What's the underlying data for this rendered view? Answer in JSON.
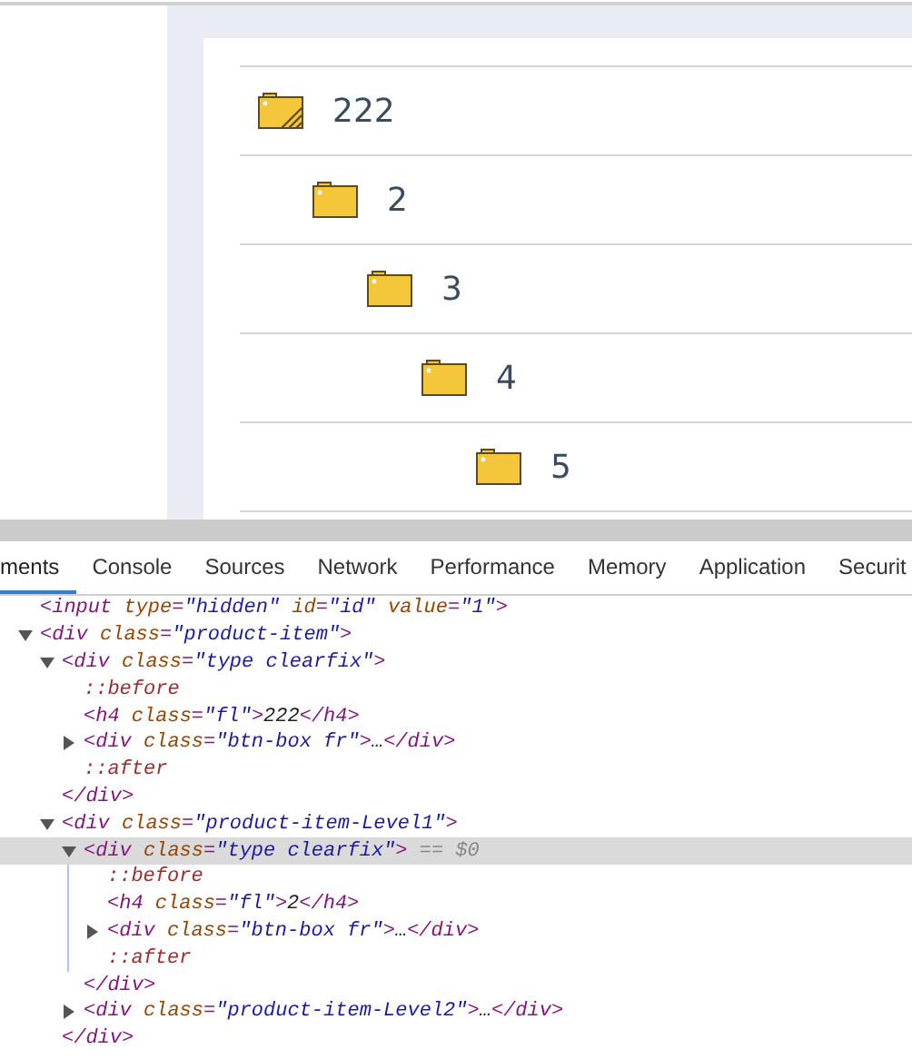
{
  "folders": [
    {
      "label": "222",
      "kind": "hatched",
      "children": [
        {
          "label": "2",
          "kind": "plain",
          "children": [
            {
              "label": "3",
              "kind": "plain",
              "children": [
                {
                  "label": "4",
                  "kind": "plain",
                  "children": [
                    {
                      "label": "5",
                      "kind": "plain"
                    }
                  ]
                }
              ]
            }
          ]
        }
      ]
    }
  ],
  "devtools": {
    "tabs": [
      {
        "label": "ments",
        "selected": true
      },
      {
        "label": "Console",
        "selected": false
      },
      {
        "label": "Sources",
        "selected": false
      },
      {
        "label": "Network",
        "selected": false
      },
      {
        "label": "Performance",
        "selected": false
      },
      {
        "label": "Memory",
        "selected": false
      },
      {
        "label": "Application",
        "selected": false
      },
      {
        "label": "Securit",
        "selected": false
      }
    ],
    "dom_tree": [
      {
        "kind": "leaf",
        "selected": false,
        "segments": [
          {
            "kind": "tag",
            "s": "<input"
          },
          {
            "kind": "attr",
            "s": " type"
          },
          {
            "kind": "tag",
            "s": "="
          },
          {
            "kind": "value",
            "s": "\"hidden\""
          },
          {
            "kind": "attr",
            "s": " id"
          },
          {
            "kind": "tag",
            "s": "="
          },
          {
            "kind": "value",
            "s": "\"id\""
          },
          {
            "kind": "attr",
            "s": " value"
          },
          {
            "kind": "tag",
            "s": "="
          },
          {
            "kind": "value",
            "s": "\"1\""
          },
          {
            "kind": "tag",
            "s": ">"
          }
        ]
      },
      {
        "kind": "parent",
        "expanded": true,
        "selected": false,
        "segments": [
          {
            "kind": "tag",
            "s": "<div"
          },
          {
            "kind": "attr",
            "s": " class"
          },
          {
            "kind": "tag",
            "s": "="
          },
          {
            "kind": "value",
            "s": "\"product-item\""
          },
          {
            "kind": "tag",
            "s": ">"
          }
        ],
        "children": [
          {
            "kind": "parent",
            "expanded": true,
            "selected": false,
            "segments": [
              {
                "kind": "tag",
                "s": "<div"
              },
              {
                "kind": "attr",
                "s": " class"
              },
              {
                "kind": "tag",
                "s": "="
              },
              {
                "kind": "value",
                "s": "\"type clearfix\""
              },
              {
                "kind": "tag",
                "s": ">"
              }
            ],
            "closing": [
              {
                "kind": "tag",
                "s": "</div>"
              }
            ],
            "children": [
              {
                "kind": "leaf",
                "selected": false,
                "segments": [
                  {
                    "kind": "pseudo",
                    "s": "::before"
                  }
                ]
              },
              {
                "kind": "leaf",
                "selected": false,
                "segments": [
                  {
                    "kind": "tag",
                    "s": "<h4"
                  },
                  {
                    "kind": "attr",
                    "s": " class"
                  },
                  {
                    "kind": "tag",
                    "s": "="
                  },
                  {
                    "kind": "value",
                    "s": "\"fl\""
                  },
                  {
                    "kind": "tag",
                    "s": ">"
                  },
                  {
                    "kind": "text",
                    "s": "222"
                  },
                  {
                    "kind": "tag",
                    "s": "</h4>"
                  }
                ]
              },
              {
                "kind": "parent",
                "expanded": false,
                "selected": false,
                "segments": [
                  {
                    "kind": "tag",
                    "s": "<div"
                  },
                  {
                    "kind": "attr",
                    "s": " class"
                  },
                  {
                    "kind": "tag",
                    "s": "="
                  },
                  {
                    "kind": "value",
                    "s": "\"btn-box fr\""
                  },
                  {
                    "kind": "tag",
                    "s": ">"
                  },
                  {
                    "kind": "text",
                    "s": "…"
                  },
                  {
                    "kind": "tag",
                    "s": "</div>"
                  }
                ]
              },
              {
                "kind": "leaf",
                "selected": false,
                "segments": [
                  {
                    "kind": "pseudo",
                    "s": "::after"
                  }
                ]
              }
            ]
          },
          {
            "kind": "parent",
            "expanded": true,
            "selected": false,
            "segments": [
              {
                "kind": "tag",
                "s": "<div"
              },
              {
                "kind": "attr",
                "s": " class"
              },
              {
                "kind": "tag",
                "s": "="
              },
              {
                "kind": "value",
                "s": "\"product-item-Level1\""
              },
              {
                "kind": "tag",
                "s": ">"
              }
            ],
            "closing": [
              {
                "kind": "tag",
                "s": "</div>"
              }
            ],
            "children": [
              {
                "kind": "parent",
                "expanded": true,
                "selected": true,
                "segments": [
                  {
                    "kind": "tag",
                    "s": "<div"
                  },
                  {
                    "kind": "attr",
                    "s": " class"
                  },
                  {
                    "kind": "tag",
                    "s": "="
                  },
                  {
                    "kind": "value",
                    "s": "\"type clearfix\""
                  },
                  {
                    "kind": "tag",
                    "s": ">"
                  },
                  {
                    "kind": "suffix",
                    "s": " == $0"
                  }
                ],
                "closing": [
                  {
                    "kind": "tag",
                    "s": "</div>"
                  }
                ],
                "children": [
                  {
                    "kind": "leaf",
                    "selected": false,
                    "segments": [
                      {
                        "kind": "pseudo",
                        "s": "::before"
                      }
                    ]
                  },
                  {
                    "kind": "leaf",
                    "selected": false,
                    "segments": [
                      {
                        "kind": "tag",
                        "s": "<h4"
                      },
                      {
                        "kind": "attr",
                        "s": " class"
                      },
                      {
                        "kind": "tag",
                        "s": "="
                      },
                      {
                        "kind": "value",
                        "s": "\"fl\""
                      },
                      {
                        "kind": "tag",
                        "s": ">"
                      },
                      {
                        "kind": "text",
                        "s": "2"
                      },
                      {
                        "kind": "tag",
                        "s": "</h4>"
                      }
                    ]
                  },
                  {
                    "kind": "parent",
                    "expanded": false,
                    "selected": false,
                    "segments": [
                      {
                        "kind": "tag",
                        "s": "<div"
                      },
                      {
                        "kind": "attr",
                        "s": " class"
                      },
                      {
                        "kind": "tag",
                        "s": "="
                      },
                      {
                        "kind": "value",
                        "s": "\"btn-box fr\""
                      },
                      {
                        "kind": "tag",
                        "s": ">"
                      },
                      {
                        "kind": "text",
                        "s": "…"
                      },
                      {
                        "kind": "tag",
                        "s": "</div>"
                      }
                    ]
                  },
                  {
                    "kind": "leaf",
                    "selected": false,
                    "segments": [
                      {
                        "kind": "pseudo",
                        "s": "::after"
                      }
                    ]
                  }
                ]
              },
              {
                "kind": "parent",
                "expanded": false,
                "selected": false,
                "segments": [
                  {
                    "kind": "tag",
                    "s": "<div"
                  },
                  {
                    "kind": "attr",
                    "s": " class"
                  },
                  {
                    "kind": "tag",
                    "s": "="
                  },
                  {
                    "kind": "value",
                    "s": "\"product-item-Level2\""
                  },
                  {
                    "kind": "tag",
                    "s": ">"
                  },
                  {
                    "kind": "text",
                    "s": "…"
                  },
                  {
                    "kind": "tag",
                    "s": "</div>"
                  }
                ]
              }
            ]
          }
        ]
      }
    ]
  }
}
